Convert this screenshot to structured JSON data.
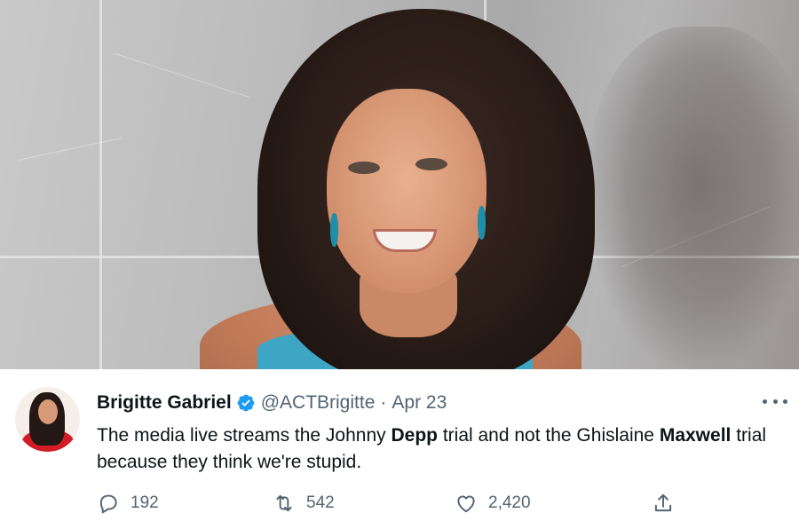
{
  "photo": {
    "icon": "profile-photo-woman-smiling"
  },
  "tweet": {
    "author_name": "Brigitte Gabriel",
    "verified_icon": "verified-badge-icon",
    "handle": "@ACTBrigitte",
    "separator": "·",
    "date": "Apr 23",
    "text_parts": {
      "p1": "The media live streams the Johnny ",
      "p2_bold": "Depp",
      "p3": " trial and not the Ghislaine ",
      "p4_bold": "Maxwell",
      "p5": " trial because they think we're stupid."
    },
    "actions": {
      "reply_count": "192",
      "retweet_count": "542",
      "like_count": "2,420"
    }
  },
  "colors": {
    "verified": "#1d9bf0",
    "secondary_text": "#536471",
    "primary_text": "#0f1419"
  }
}
